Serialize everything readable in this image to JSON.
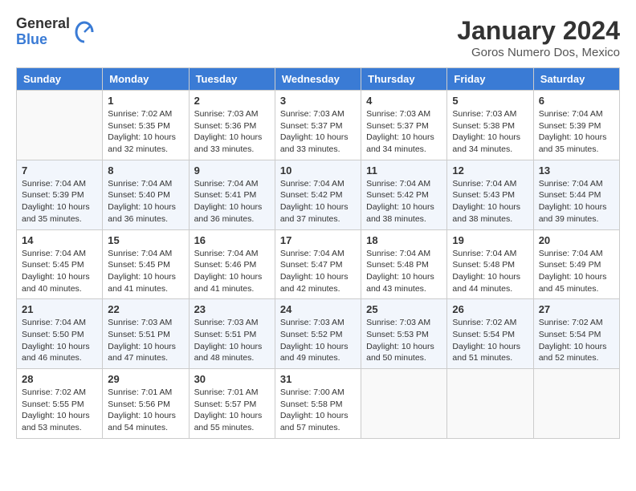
{
  "logo": {
    "general": "General",
    "blue": "Blue"
  },
  "title": "January 2024",
  "location": "Goros Numero Dos, Mexico",
  "days_of_week": [
    "Sunday",
    "Monday",
    "Tuesday",
    "Wednesday",
    "Thursday",
    "Friday",
    "Saturday"
  ],
  "weeks": [
    [
      {
        "day": "",
        "info": ""
      },
      {
        "day": "1",
        "info": "Sunrise: 7:02 AM\nSunset: 5:35 PM\nDaylight: 10 hours\nand 32 minutes."
      },
      {
        "day": "2",
        "info": "Sunrise: 7:03 AM\nSunset: 5:36 PM\nDaylight: 10 hours\nand 33 minutes."
      },
      {
        "day": "3",
        "info": "Sunrise: 7:03 AM\nSunset: 5:37 PM\nDaylight: 10 hours\nand 33 minutes."
      },
      {
        "day": "4",
        "info": "Sunrise: 7:03 AM\nSunset: 5:37 PM\nDaylight: 10 hours\nand 34 minutes."
      },
      {
        "day": "5",
        "info": "Sunrise: 7:03 AM\nSunset: 5:38 PM\nDaylight: 10 hours\nand 34 minutes."
      },
      {
        "day": "6",
        "info": "Sunrise: 7:04 AM\nSunset: 5:39 PM\nDaylight: 10 hours\nand 35 minutes."
      }
    ],
    [
      {
        "day": "7",
        "info": "Sunrise: 7:04 AM\nSunset: 5:39 PM\nDaylight: 10 hours\nand 35 minutes."
      },
      {
        "day": "8",
        "info": "Sunrise: 7:04 AM\nSunset: 5:40 PM\nDaylight: 10 hours\nand 36 minutes."
      },
      {
        "day": "9",
        "info": "Sunrise: 7:04 AM\nSunset: 5:41 PM\nDaylight: 10 hours\nand 36 minutes."
      },
      {
        "day": "10",
        "info": "Sunrise: 7:04 AM\nSunset: 5:42 PM\nDaylight: 10 hours\nand 37 minutes."
      },
      {
        "day": "11",
        "info": "Sunrise: 7:04 AM\nSunset: 5:42 PM\nDaylight: 10 hours\nand 38 minutes."
      },
      {
        "day": "12",
        "info": "Sunrise: 7:04 AM\nSunset: 5:43 PM\nDaylight: 10 hours\nand 38 minutes."
      },
      {
        "day": "13",
        "info": "Sunrise: 7:04 AM\nSunset: 5:44 PM\nDaylight: 10 hours\nand 39 minutes."
      }
    ],
    [
      {
        "day": "14",
        "info": "Sunrise: 7:04 AM\nSunset: 5:45 PM\nDaylight: 10 hours\nand 40 minutes."
      },
      {
        "day": "15",
        "info": "Sunrise: 7:04 AM\nSunset: 5:45 PM\nDaylight: 10 hours\nand 41 minutes."
      },
      {
        "day": "16",
        "info": "Sunrise: 7:04 AM\nSunset: 5:46 PM\nDaylight: 10 hours\nand 41 minutes."
      },
      {
        "day": "17",
        "info": "Sunrise: 7:04 AM\nSunset: 5:47 PM\nDaylight: 10 hours\nand 42 minutes."
      },
      {
        "day": "18",
        "info": "Sunrise: 7:04 AM\nSunset: 5:48 PM\nDaylight: 10 hours\nand 43 minutes."
      },
      {
        "day": "19",
        "info": "Sunrise: 7:04 AM\nSunset: 5:48 PM\nDaylight: 10 hours\nand 44 minutes."
      },
      {
        "day": "20",
        "info": "Sunrise: 7:04 AM\nSunset: 5:49 PM\nDaylight: 10 hours\nand 45 minutes."
      }
    ],
    [
      {
        "day": "21",
        "info": "Sunrise: 7:04 AM\nSunset: 5:50 PM\nDaylight: 10 hours\nand 46 minutes."
      },
      {
        "day": "22",
        "info": "Sunrise: 7:03 AM\nSunset: 5:51 PM\nDaylight: 10 hours\nand 47 minutes."
      },
      {
        "day": "23",
        "info": "Sunrise: 7:03 AM\nSunset: 5:51 PM\nDaylight: 10 hours\nand 48 minutes."
      },
      {
        "day": "24",
        "info": "Sunrise: 7:03 AM\nSunset: 5:52 PM\nDaylight: 10 hours\nand 49 minutes."
      },
      {
        "day": "25",
        "info": "Sunrise: 7:03 AM\nSunset: 5:53 PM\nDaylight: 10 hours\nand 50 minutes."
      },
      {
        "day": "26",
        "info": "Sunrise: 7:02 AM\nSunset: 5:54 PM\nDaylight: 10 hours\nand 51 minutes."
      },
      {
        "day": "27",
        "info": "Sunrise: 7:02 AM\nSunset: 5:54 PM\nDaylight: 10 hours\nand 52 minutes."
      }
    ],
    [
      {
        "day": "28",
        "info": "Sunrise: 7:02 AM\nSunset: 5:55 PM\nDaylight: 10 hours\nand 53 minutes."
      },
      {
        "day": "29",
        "info": "Sunrise: 7:01 AM\nSunset: 5:56 PM\nDaylight: 10 hours\nand 54 minutes."
      },
      {
        "day": "30",
        "info": "Sunrise: 7:01 AM\nSunset: 5:57 PM\nDaylight: 10 hours\nand 55 minutes."
      },
      {
        "day": "31",
        "info": "Sunrise: 7:00 AM\nSunset: 5:58 PM\nDaylight: 10 hours\nand 57 minutes."
      },
      {
        "day": "",
        "info": ""
      },
      {
        "day": "",
        "info": ""
      },
      {
        "day": "",
        "info": ""
      }
    ]
  ]
}
